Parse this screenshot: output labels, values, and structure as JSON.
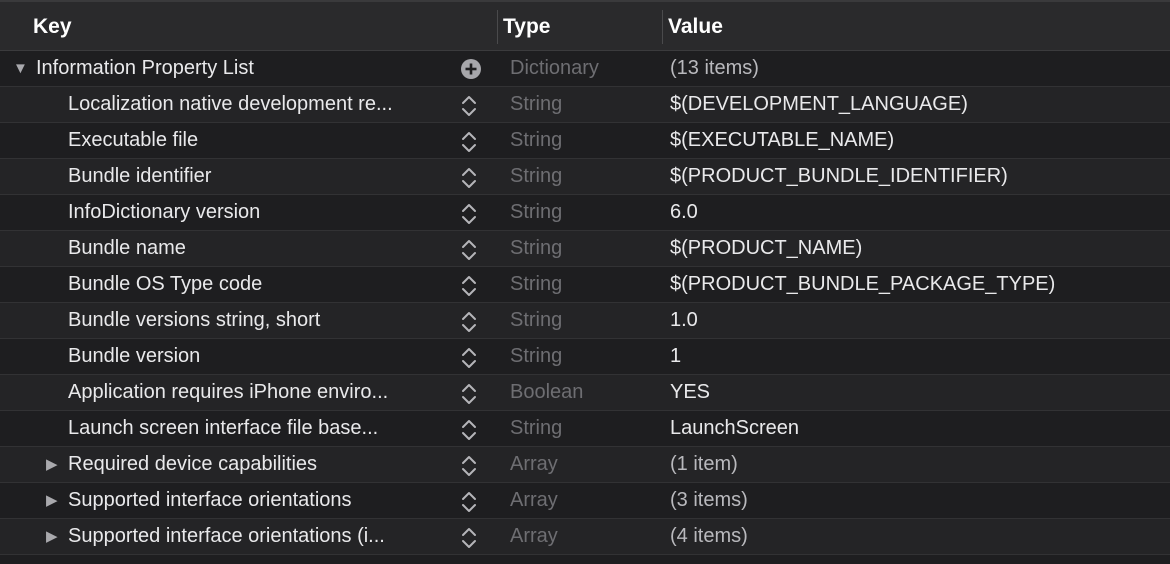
{
  "header": {
    "key_label": "Key",
    "type_label": "Type",
    "value_label": "Value"
  },
  "rows": [
    {
      "key": "Information Property List",
      "type": "Dictionary",
      "value": "(13 items)",
      "indent": 0,
      "disclosure": "expanded",
      "control": "add",
      "muted": true
    },
    {
      "key": "Localization native development re...",
      "type": "String",
      "value": "$(DEVELOPMENT_LANGUAGE)",
      "indent": 1,
      "disclosure": "none",
      "control": "stepper",
      "muted": false
    },
    {
      "key": "Executable file",
      "type": "String",
      "value": "$(EXECUTABLE_NAME)",
      "indent": 1,
      "disclosure": "none",
      "control": "stepper",
      "muted": false
    },
    {
      "key": "Bundle identifier",
      "type": "String",
      "value": "$(PRODUCT_BUNDLE_IDENTIFIER)",
      "indent": 1,
      "disclosure": "none",
      "control": "stepper",
      "muted": false
    },
    {
      "key": "InfoDictionary version",
      "type": "String",
      "value": "6.0",
      "indent": 1,
      "disclosure": "none",
      "control": "stepper",
      "muted": false
    },
    {
      "key": "Bundle name",
      "type": "String",
      "value": "$(PRODUCT_NAME)",
      "indent": 1,
      "disclosure": "none",
      "control": "stepper",
      "muted": false
    },
    {
      "key": "Bundle OS Type code",
      "type": "String",
      "value": "$(PRODUCT_BUNDLE_PACKAGE_TYPE)",
      "indent": 1,
      "disclosure": "none",
      "control": "stepper",
      "muted": false
    },
    {
      "key": "Bundle versions string, short",
      "type": "String",
      "value": "1.0",
      "indent": 1,
      "disclosure": "none",
      "control": "stepper",
      "muted": false
    },
    {
      "key": "Bundle version",
      "type": "String",
      "value": "1",
      "indent": 1,
      "disclosure": "none",
      "control": "stepper",
      "muted": false
    },
    {
      "key": "Application requires iPhone enviro...",
      "type": "Boolean",
      "value": "YES",
      "indent": 1,
      "disclosure": "none",
      "control": "stepper",
      "muted": false
    },
    {
      "key": "Launch screen interface file base...",
      "type": "String",
      "value": "LaunchScreen",
      "indent": 1,
      "disclosure": "none",
      "control": "stepper",
      "muted": false
    },
    {
      "key": "Required device capabilities",
      "type": "Array",
      "value": "(1 item)",
      "indent": 1,
      "disclosure": "collapsed",
      "control": "stepper",
      "muted": true
    },
    {
      "key": "Supported interface orientations",
      "type": "Array",
      "value": "(3 items)",
      "indent": 1,
      "disclosure": "collapsed",
      "control": "stepper",
      "muted": true
    },
    {
      "key": "Supported interface orientations (i...",
      "type": "Array",
      "value": "(4 items)",
      "indent": 1,
      "disclosure": "collapsed",
      "control": "stepper",
      "muted": true
    }
  ],
  "icons": {
    "expanded": "disclosure-triangle-down-icon",
    "collapsed": "disclosure-triangle-right-icon",
    "add": "plus-circle-icon",
    "stepper": "up-down-chevron-icon"
  },
  "colors": {
    "background": "#1e1e20",
    "header_background": "#2a2a2c",
    "text": "#e9e9eb",
    "type_text": "#6e6e72"
  }
}
